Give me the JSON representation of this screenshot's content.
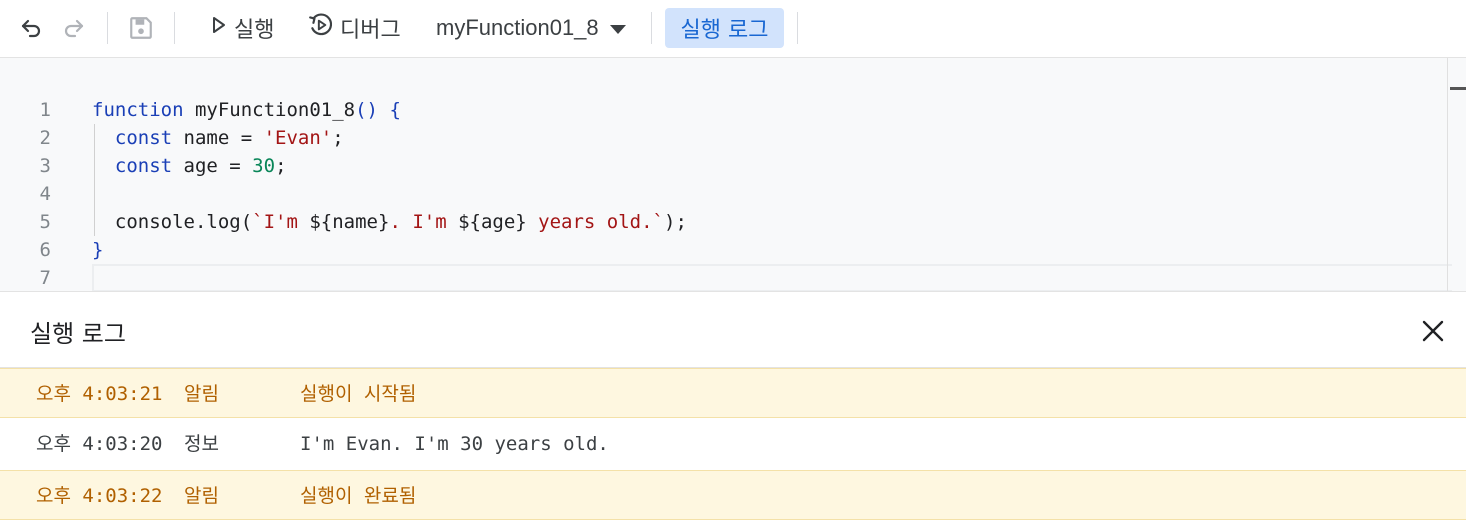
{
  "toolbar": {
    "run_label": "실행",
    "debug_label": "디버그",
    "function_name": "myFunction01_8",
    "log_label": "실행 로그"
  },
  "editor": {
    "line_numbers": [
      "1",
      "2",
      "3",
      "4",
      "5",
      "6",
      "7"
    ],
    "lines": [
      [
        [
          "k",
          "function"
        ],
        [
          "p",
          " myFunction01_8"
        ],
        [
          "b",
          "()"
        ],
        [
          "p",
          " "
        ],
        [
          "b",
          "{"
        ]
      ],
      [
        [
          "p",
          "  "
        ],
        [
          "k",
          "const"
        ],
        [
          "p",
          " name = "
        ],
        [
          "s",
          "'Evan'"
        ],
        [
          "p",
          ";"
        ]
      ],
      [
        [
          "p",
          "  "
        ],
        [
          "k",
          "const"
        ],
        [
          "p",
          " age = "
        ],
        [
          "n",
          "30"
        ],
        [
          "p",
          ";"
        ]
      ],
      [],
      [
        [
          "p",
          "  console.log("
        ],
        [
          "s",
          "`I'm "
        ],
        [
          "p",
          "${name}"
        ],
        [
          "s",
          ". I'm "
        ],
        [
          "p",
          "${age}"
        ],
        [
          "s",
          " years old.`"
        ],
        [
          "p",
          ");"
        ]
      ],
      [
        [
          "b",
          "}"
        ]
      ],
      []
    ]
  },
  "log": {
    "title": "실행 로그",
    "rows": [
      {
        "time": "오후 4:03:21",
        "level": "알림",
        "message": "실행이 시작됨",
        "type": "warn"
      },
      {
        "time": "오후 4:03:20",
        "level": "정보",
        "message": "I'm Evan. I'm 30 years old.",
        "type": "info"
      },
      {
        "time": "오후 4:03:22",
        "level": "알림",
        "message": "실행이 완료됨",
        "type": "warn"
      }
    ]
  }
}
